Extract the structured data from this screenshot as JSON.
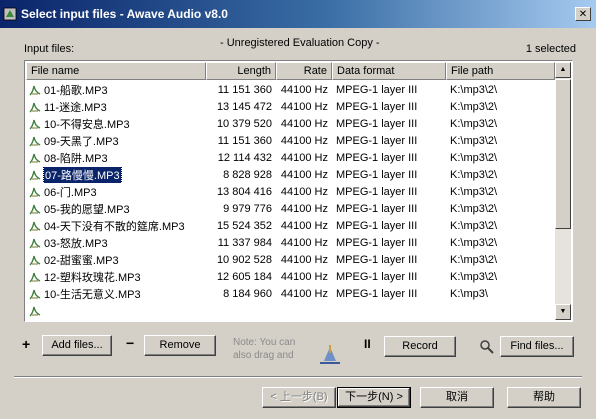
{
  "window": {
    "title": "Select input files - Awave Audio v8.0",
    "close": "✕"
  },
  "labels": {
    "input_files": "Input files:",
    "eval": "- Unregistered Evaluation Copy -",
    "selected": "1 selected"
  },
  "columns": [
    "File name",
    "Length",
    "Rate",
    "Data format",
    "File path"
  ],
  "files": [
    {
      "name": "01-船歌.MP3",
      "length": "11 151 360",
      "rate": "44100 Hz",
      "format": "MPEG-1 layer III",
      "path": "K:\\mp3\\2\\"
    },
    {
      "name": "11-迷途.MP3",
      "length": "13 145 472",
      "rate": "44100 Hz",
      "format": "MPEG-1 layer III",
      "path": "K:\\mp3\\2\\"
    },
    {
      "name": "10-不得安息.MP3",
      "length": "10 379 520",
      "rate": "44100 Hz",
      "format": "MPEG-1 layer III",
      "path": "K:\\mp3\\2\\"
    },
    {
      "name": "09-天黑了.MP3",
      "length": "11 151 360",
      "rate": "44100 Hz",
      "format": "MPEG-1 layer III",
      "path": "K:\\mp3\\2\\"
    },
    {
      "name": "08-陷阱.MP3",
      "length": "12 114 432",
      "rate": "44100 Hz",
      "format": "MPEG-1 layer III",
      "path": "K:\\mp3\\2\\"
    },
    {
      "name": "07-路慢慢.MP3",
      "length": "8 828 928",
      "rate": "44100 Hz",
      "format": "MPEG-1 layer III",
      "path": "K:\\mp3\\2\\"
    },
    {
      "name": "06-门.MP3",
      "length": "13 804 416",
      "rate": "44100 Hz",
      "format": "MPEG-1 layer III",
      "path": "K:\\mp3\\2\\"
    },
    {
      "name": "05-我的愿望.MP3",
      "length": "9 979 776",
      "rate": "44100 Hz",
      "format": "MPEG-1 layer III",
      "path": "K:\\mp3\\2\\"
    },
    {
      "name": "04-天下没有不散的筵席.MP3",
      "length": "15 524 352",
      "rate": "44100 Hz",
      "format": "MPEG-1 layer III",
      "path": "K:\\mp3\\2\\"
    },
    {
      "name": "03-怒放.MP3",
      "length": "11 337 984",
      "rate": "44100 Hz",
      "format": "MPEG-1 layer III",
      "path": "K:\\mp3\\2\\"
    },
    {
      "name": "02-甜蜜蜜.MP3",
      "length": "10 902 528",
      "rate": "44100 Hz",
      "format": "MPEG-1 layer III",
      "path": "K:\\mp3\\2\\"
    },
    {
      "name": "12-塑料玫瑰花.MP3",
      "length": "12 605 184",
      "rate": "44100 Hz",
      "format": "MPEG-1 layer III",
      "path": "K:\\mp3\\2\\"
    },
    {
      "name": "10-生活无意义.MP3",
      "length": "8 184 960",
      "rate": "44100 Hz",
      "format": "MPEG-1 layer III",
      "path": "K:\\mp3\\"
    },
    {
      "name": "",
      "length": "",
      "rate": "",
      "format": "",
      "path": ""
    }
  ],
  "selected_index": 5,
  "buttons": {
    "plus": "+",
    "add_files": "Add files...",
    "minus": "−",
    "remove": "Remove",
    "note": "Note: You can also drag and",
    "record_icon": "II",
    "record": "Record",
    "find_files": "Find files...",
    "back": "< 上一步(B)",
    "next": "下一步(N) >",
    "cancel": "取消",
    "help": "帮助"
  },
  "colors": {
    "selection": "#0a246a",
    "face": "#d4d0c8"
  }
}
